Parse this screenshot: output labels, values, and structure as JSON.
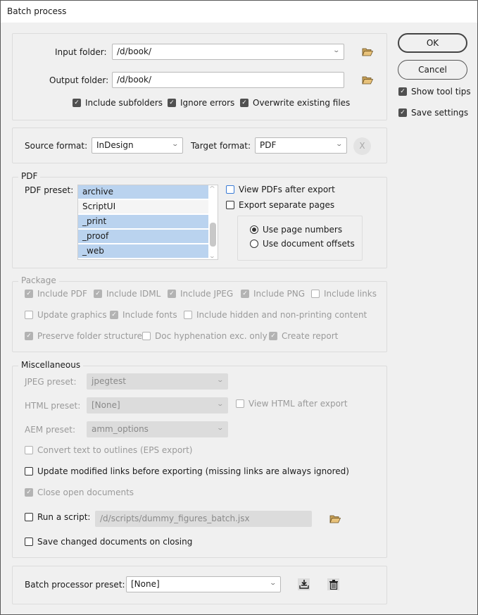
{
  "window": {
    "title": "Batch process"
  },
  "folders": {
    "input_label": "Input folder:",
    "input_value": "/d/book/",
    "output_label": "Output folder:",
    "output_value": "/d/book/",
    "options": [
      {
        "label": "Include subfolders",
        "checked": true
      },
      {
        "label": "Ignore errors",
        "checked": true
      },
      {
        "label": "Overwrite existing files",
        "checked": true
      }
    ]
  },
  "formats": {
    "source_label": "Source format:",
    "source_value": "InDesign",
    "target_label": "Target format:",
    "target_value": "PDF",
    "clear_label": "X"
  },
  "pdf": {
    "group_label": "PDF",
    "preset_label": "PDF preset:",
    "presets": [
      {
        "label": "archive",
        "selected": true
      },
      {
        "label": "ScriptUI",
        "selected": false
      },
      {
        "label": "_print",
        "selected": true
      },
      {
        "label": "_proof",
        "selected": true
      },
      {
        "label": "_web",
        "selected": true
      }
    ],
    "view_after_export": {
      "label": "View PDFs after export",
      "checked": false
    },
    "export_separate_pages": {
      "label": "Export separate pages",
      "checked": false
    },
    "page_mode": [
      {
        "label": "Use page numbers",
        "selected": true
      },
      {
        "label": "Use document offsets",
        "selected": false
      }
    ]
  },
  "package": {
    "group_label": "Package",
    "rows": [
      [
        {
          "label": "Include PDF",
          "checked": true
        },
        {
          "label": "Include IDML",
          "checked": true
        },
        {
          "label": "Include JPEG",
          "checked": true
        },
        {
          "label": "Include PNG",
          "checked": true
        },
        {
          "label": "Include links",
          "checked": false
        }
      ],
      [
        {
          "label": "Update graphics",
          "checked": false
        },
        {
          "label": "Include fonts",
          "checked": true
        },
        {
          "label": "Include hidden and non-printing content",
          "checked": false
        }
      ],
      [
        {
          "label": "Preserve folder structure",
          "checked": true
        },
        {
          "label": "Doc hyphenation exc. only",
          "checked": false
        },
        {
          "label": "Create report",
          "checked": true
        }
      ]
    ]
  },
  "misc": {
    "group_label": "Miscellaneous",
    "jpeg_label": "JPEG preset:",
    "jpeg_value": "jpegtest",
    "html_label": "HTML preset:",
    "html_value": "[None]",
    "view_html": {
      "label": "View HTML after export",
      "checked": false
    },
    "aem_label": "AEM preset:",
    "aem_value": "amm_options",
    "convert_outlines": {
      "label": "Convert text to outlines (EPS export)",
      "checked": false
    },
    "update_links": {
      "label": "Update modified links before exporting (missing links are always ignored)",
      "checked": false
    },
    "close_docs": {
      "label": "Close open documents",
      "checked": true
    },
    "run_script": {
      "label": "Run a script:",
      "checked": false
    },
    "script_path": "/d/scripts/dummy_figures_batch.jsx",
    "save_changed": {
      "label": "Save changed documents on closing",
      "checked": false
    }
  },
  "preset": {
    "label": "Batch processor preset:",
    "value": "[None]"
  },
  "side": {
    "ok_label": "OK",
    "cancel_label": "Cancel",
    "show_tips": {
      "label": "Show tool tips",
      "checked": true
    },
    "save_settings": {
      "label": "Save settings",
      "checked": true
    }
  },
  "icons": {
    "folder": "folder-open-icon",
    "save_preset": "save-download-icon",
    "delete_preset": "trash-icon",
    "dropdown": "chevron-down-icon"
  }
}
